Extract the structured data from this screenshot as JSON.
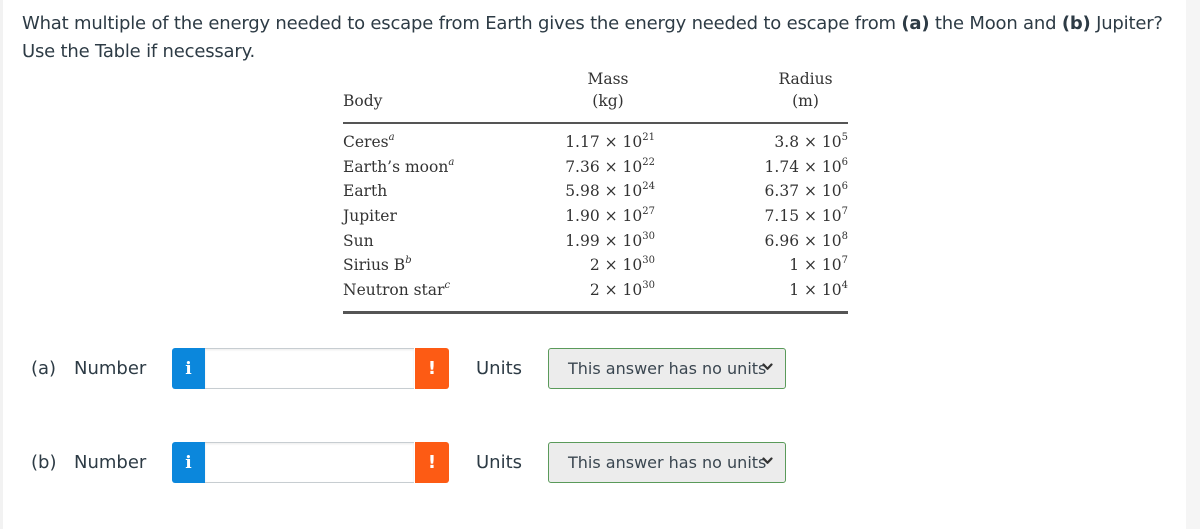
{
  "question": {
    "part1": "What multiple of the energy needed to escape from Earth gives the energy needed to escape from ",
    "a_marker": "(a)",
    "part2": " the Moon and ",
    "b_marker": "(b)",
    "part3": " Jupiter? Use the Table if necessary."
  },
  "table": {
    "headers": {
      "body": "Body",
      "mass_line1": "Mass",
      "mass_line2": "(kg)",
      "radius_line1": "Radius",
      "radius_line2": "(m)"
    },
    "rows": [
      {
        "name": "Ceres",
        "footnote": "a",
        "mass_mant": "1.17 × 10",
        "mass_exp": "21",
        "radius_mant": "3.8 × 10",
        "radius_exp": "5"
      },
      {
        "name": "Earth’s moon",
        "footnote": "a",
        "mass_mant": "7.36 × 10",
        "mass_exp": "22",
        "radius_mant": "1.74 × 10",
        "radius_exp": "6"
      },
      {
        "name": "Earth",
        "footnote": "",
        "mass_mant": "5.98 × 10",
        "mass_exp": "24",
        "radius_mant": "6.37 × 10",
        "radius_exp": "6"
      },
      {
        "name": "Jupiter",
        "footnote": "",
        "mass_mant": "1.90 × 10",
        "mass_exp": "27",
        "radius_mant": "7.15 × 10",
        "radius_exp": "7"
      },
      {
        "name": "Sun",
        "footnote": "",
        "mass_mant": "1.99 × 10",
        "mass_exp": "30",
        "radius_mant": "6.96 × 10",
        "radius_exp": "8"
      },
      {
        "name": "Sirius B",
        "footnote": "b",
        "mass_mant": "2 × 10",
        "mass_exp": "30",
        "radius_mant": "1 × 10",
        "radius_exp": "7"
      },
      {
        "name": "Neutron star",
        "footnote": "c",
        "mass_mant": "2 × 10",
        "mass_exp": "30",
        "radius_mant": "1 × 10",
        "radius_exp": "4"
      }
    ]
  },
  "answers": [
    {
      "part": "(a)",
      "number_label": "Number",
      "info_icon": "i",
      "warn_icon": "!",
      "value": "",
      "units_label": "Units",
      "units_selected": "This answer has no units"
    },
    {
      "part": "(b)",
      "number_label": "Number",
      "info_icon": "i",
      "warn_icon": "!",
      "value": "",
      "units_label": "Units",
      "units_selected": "This answer has no units"
    }
  ],
  "colors": {
    "info": "#0b87dc",
    "warning": "#fd5b14",
    "select_border": "#5a9a5a",
    "select_bg": "#ececec",
    "text": "#2d3b45"
  }
}
